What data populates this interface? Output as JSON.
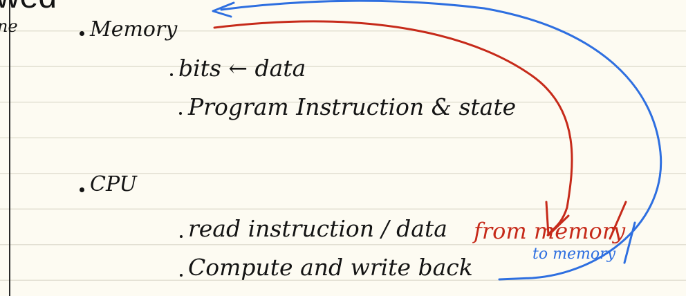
{
  "page": {
    "title_fragment": "wed",
    "margin_fragment": "ne"
  },
  "notes": {
    "memory": {
      "heading": "Memory",
      "items": [
        "bits ← data",
        "Program Instruction & state"
      ]
    },
    "cpu": {
      "heading": "CPU",
      "items": [
        "read instruction / data",
        "Compute and write back"
      ]
    }
  },
  "annotations": {
    "red": {
      "text": "from memory",
      "color": "#c62a1a"
    },
    "blue": {
      "text": "to memory",
      "color": "#2e6fe0"
    }
  },
  "colors": {
    "paper": "#fdfbf2",
    "rule_line": "#e3e0d3",
    "ink": "#141414"
  }
}
